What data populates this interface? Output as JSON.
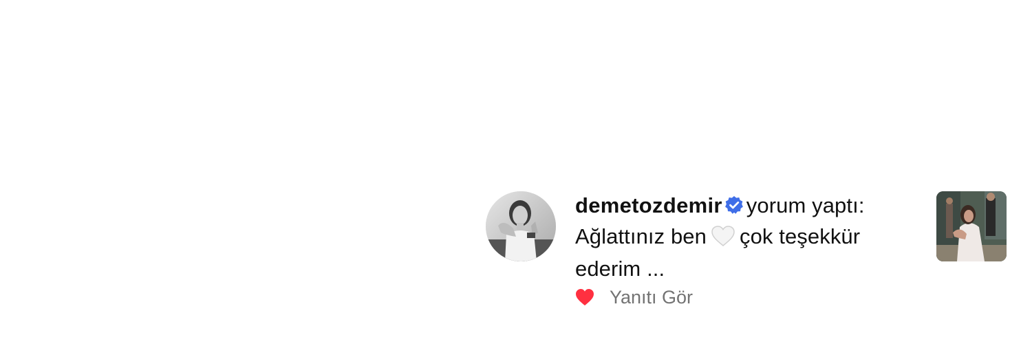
{
  "notification": {
    "username": "demetozdemir",
    "verified": true,
    "action_text": "yorum yaptı:",
    "comment_part1": "Ağlattınız ben",
    "comment_emoji": "white-heart-emoji",
    "comment_part2": "çok teşekkür ederim ...",
    "liked": true,
    "like_color": "#ff3040",
    "verified_color": "#3f6ee8",
    "reply_label": "Yanıtı Gör"
  }
}
